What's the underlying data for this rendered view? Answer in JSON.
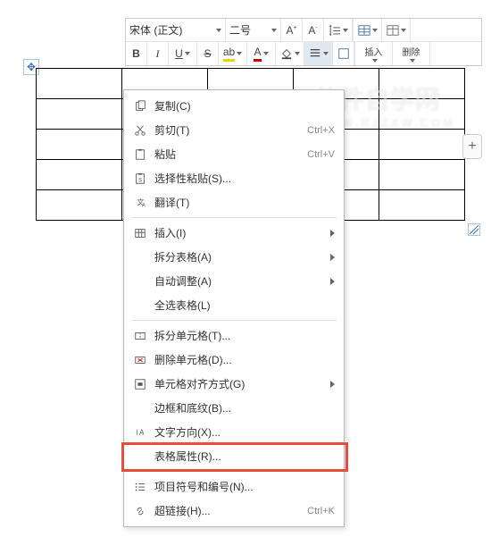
{
  "toolbar": {
    "font_family": "宋体 (正文)",
    "font_size": "二号",
    "row2": {
      "bold": "B",
      "italic": "I",
      "underline": "U",
      "strike": "S",
      "insert_label": "插入",
      "delete_label": "删除"
    }
  },
  "context_menu": [
    {
      "icon": "copy",
      "label": "复制(C)",
      "shortcut": "",
      "submenu": false
    },
    {
      "icon": "cut",
      "label": "剪切(T)",
      "shortcut": "Ctrl+X",
      "submenu": false
    },
    {
      "icon": "paste",
      "label": "粘贴",
      "shortcut": "Ctrl+V",
      "submenu": false
    },
    {
      "icon": "paste-special",
      "label": "选择性粘贴(S)...",
      "shortcut": "",
      "submenu": false
    },
    {
      "icon": "translate",
      "label": "翻译(T)",
      "shortcut": "",
      "submenu": false
    },
    {
      "sep": true
    },
    {
      "icon": "insert",
      "label": "插入(I)",
      "shortcut": "",
      "submenu": true
    },
    {
      "icon": "",
      "label": "拆分表格(A)",
      "shortcut": "",
      "submenu": true
    },
    {
      "icon": "",
      "label": "自动调整(A)",
      "shortcut": "",
      "submenu": true
    },
    {
      "icon": "",
      "label": "全选表格(L)",
      "shortcut": "",
      "submenu": false
    },
    {
      "sep": true
    },
    {
      "icon": "split-cell",
      "label": "拆分单元格(T)...",
      "shortcut": "",
      "submenu": false
    },
    {
      "icon": "delete-cell",
      "label": "删除单元格(D)...",
      "shortcut": "",
      "submenu": false
    },
    {
      "icon": "align",
      "label": "单元格对齐方式(G)",
      "shortcut": "",
      "submenu": true
    },
    {
      "icon": "",
      "label": "边框和底纹(B)...",
      "shortcut": "",
      "submenu": false
    },
    {
      "icon": "text-dir",
      "label": "文字方向(X)...",
      "shortcut": "",
      "submenu": false
    },
    {
      "icon": "",
      "label": "表格属性(R)...",
      "shortcut": "",
      "submenu": false,
      "highlight": true
    },
    {
      "sep": true
    },
    {
      "icon": "bullets",
      "label": "项目符号和编号(N)...",
      "shortcut": "",
      "submenu": false
    },
    {
      "icon": "link",
      "label": "超链接(H)...",
      "shortcut": "Ctrl+K",
      "submenu": false
    }
  ],
  "watermark": {
    "line1": "软件自学网",
    "line2": "WWW.RJZXW.COM"
  },
  "handles": {
    "move": "✥",
    "add": "+"
  }
}
